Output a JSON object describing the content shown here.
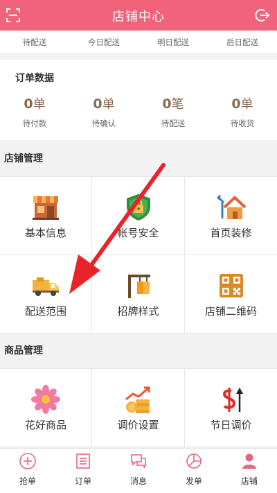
{
  "header": {
    "title": "店铺中心"
  },
  "delivery_tabs": [
    "待配送",
    "今日配送",
    "明日配送",
    "后日配送"
  ],
  "order_data": {
    "title": "订单数据",
    "stats": [
      {
        "num": "0",
        "unit": "单",
        "label": "待付款"
      },
      {
        "num": "0",
        "unit": "单",
        "label": "待确认"
      },
      {
        "num": "0",
        "unit": "笔",
        "label": "待配送"
      },
      {
        "num": "0",
        "unit": "单",
        "label": "待收货"
      }
    ]
  },
  "shop_management": {
    "title": "店铺管理",
    "items": [
      {
        "label": "基本信息",
        "icon": "store-icon"
      },
      {
        "label": "帐号安全",
        "icon": "shield-lock-icon"
      },
      {
        "label": "首页装修",
        "icon": "house-tools-icon"
      },
      {
        "label": "配送范围",
        "icon": "delivery-truck-icon"
      },
      {
        "label": "招牌样式",
        "icon": "signboard-icon"
      },
      {
        "label": "店铺二维码",
        "icon": "qr-code-icon"
      }
    ]
  },
  "goods_management": {
    "title": "商品管理",
    "items": [
      {
        "label": "花好商品",
        "icon": "flower-icon"
      },
      {
        "label": "调价设置",
        "icon": "coins-chart-icon"
      },
      {
        "label": "节日调价",
        "icon": "dollar-arrow-icon"
      }
    ]
  },
  "tabbar": [
    {
      "label": "抢单",
      "icon": "plus-circle-icon"
    },
    {
      "label": "订单",
      "icon": "list-icon"
    },
    {
      "label": "消息",
      "icon": "chat-icon"
    },
    {
      "label": "发单",
      "icon": "pie-chart-icon"
    },
    {
      "label": "店铺",
      "icon": "user-icon",
      "active": true
    }
  ],
  "colors": {
    "brand": "#f0637a",
    "stat_number": "#8a6a4e",
    "annotation_arrow": "#e8232a"
  }
}
